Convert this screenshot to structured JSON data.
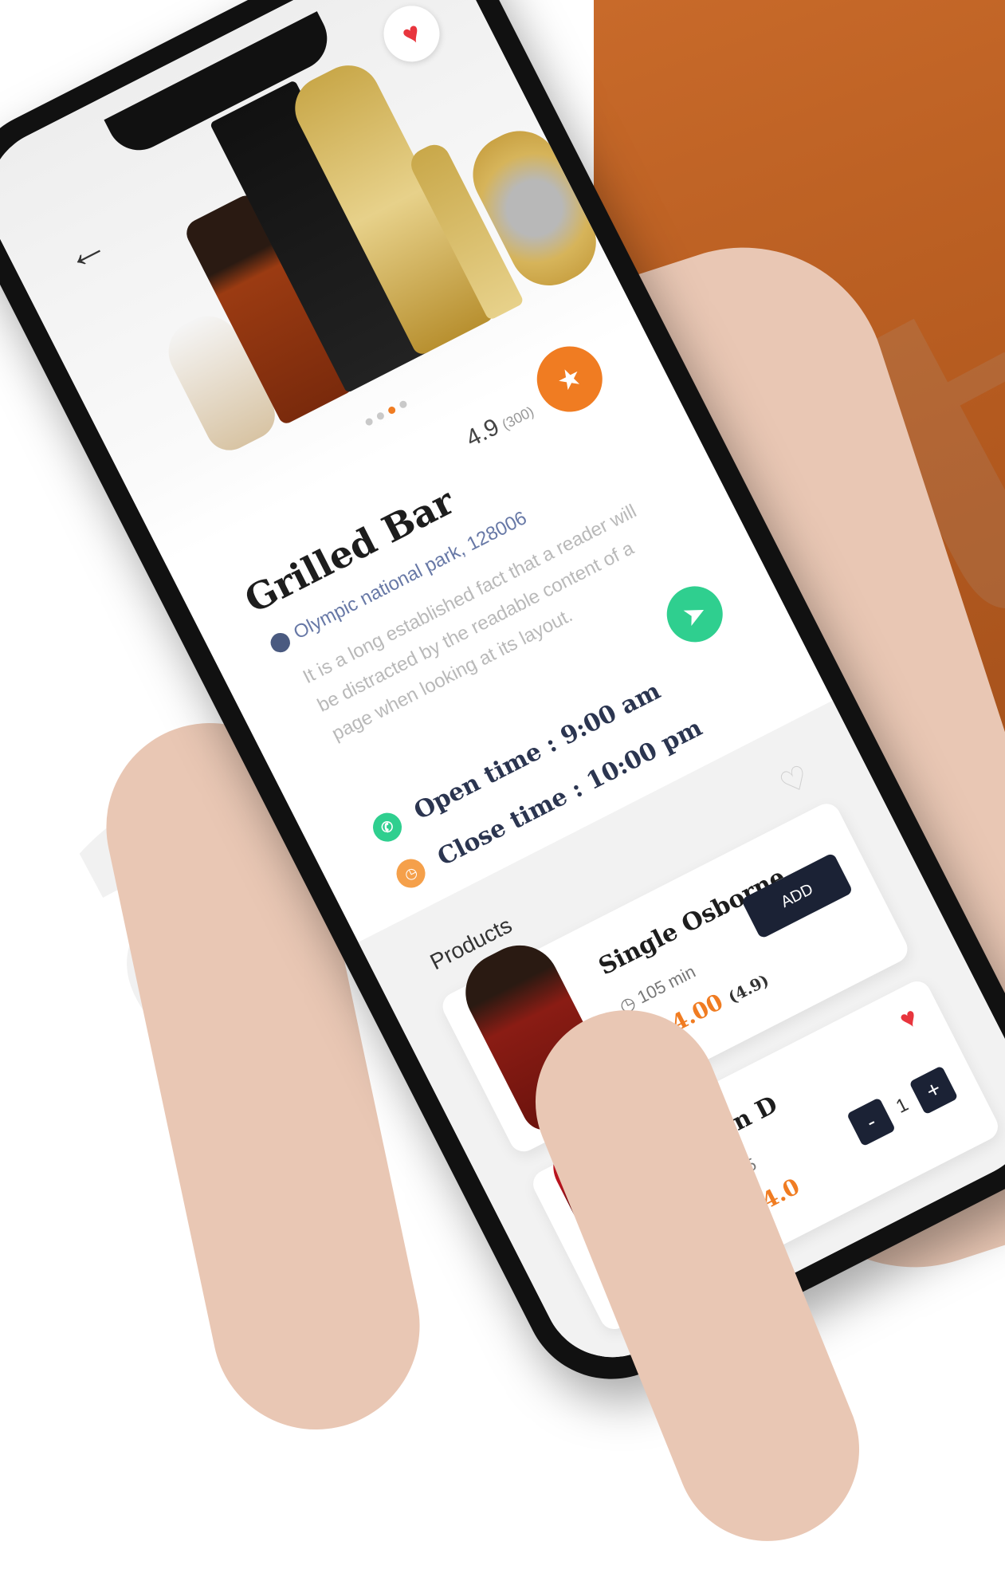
{
  "header": {
    "back_icon": "arrow-left-icon",
    "favorite_icon": "heart-icon"
  },
  "hero": {
    "carousel_dots": 4,
    "active_dot": 3
  },
  "venue": {
    "rating": "4.9",
    "review_count": "(300)",
    "name": "Grilled Bar",
    "location": "Olympic national park, 128006",
    "description": "It is a long established fact that a reader will be distracted by the readable content of a page when looking at its layout.",
    "open_time": "Open time : 9:00 am",
    "close_time": "Close time : 10:00 pm"
  },
  "products": {
    "label": "Products",
    "items": [
      {
        "name": "Single Osborne",
        "time": "105 min",
        "price": "$ 44.00",
        "rating": "(4.9)",
        "action": "ADD"
      },
      {
        "name": "Gran D",
        "time": "105",
        "price": "$ 44.0",
        "quantity": "1",
        "minus": "-",
        "plus": "+"
      }
    ]
  },
  "colors": {
    "accent": "#f07c22",
    "dark": "#1b2235",
    "green": "#2fcf8f",
    "heart": "#e8353d",
    "panel": "#c86a2a"
  }
}
